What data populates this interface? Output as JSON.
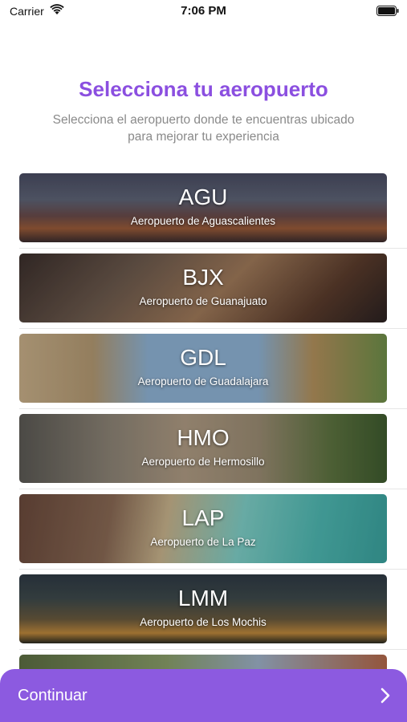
{
  "status_bar": {
    "carrier": "Carrier",
    "time": "7:06 PM",
    "icons": [
      "wifi-icon",
      "battery-icon"
    ]
  },
  "header": {
    "title": "Selecciona tu aeropuerto",
    "subtitle": "Selecciona el aeropuerto donde te encuentras ubicado para mejorar tu experiencia"
  },
  "airports": [
    {
      "code": "AGU",
      "name": "Aeropuerto de Aguascalientes"
    },
    {
      "code": "BJX",
      "name": "Aeropuerto de Guanajuato"
    },
    {
      "code": "GDL",
      "name": "Aeropuerto de Guadalajara"
    },
    {
      "code": "HMO",
      "name": "Aeropuerto de Hermosillo"
    },
    {
      "code": "LAP",
      "name": "Aeropuerto de La Paz"
    },
    {
      "code": "LMM",
      "name": "Aeropuerto de Los Mochis"
    }
  ],
  "footer": {
    "continue_label": "Continuar",
    "icon": "chevron-right-icon"
  },
  "colors": {
    "accent": "#8c5ae0",
    "title": "#8b4fe0",
    "subtitle": "#8a8a8a"
  }
}
